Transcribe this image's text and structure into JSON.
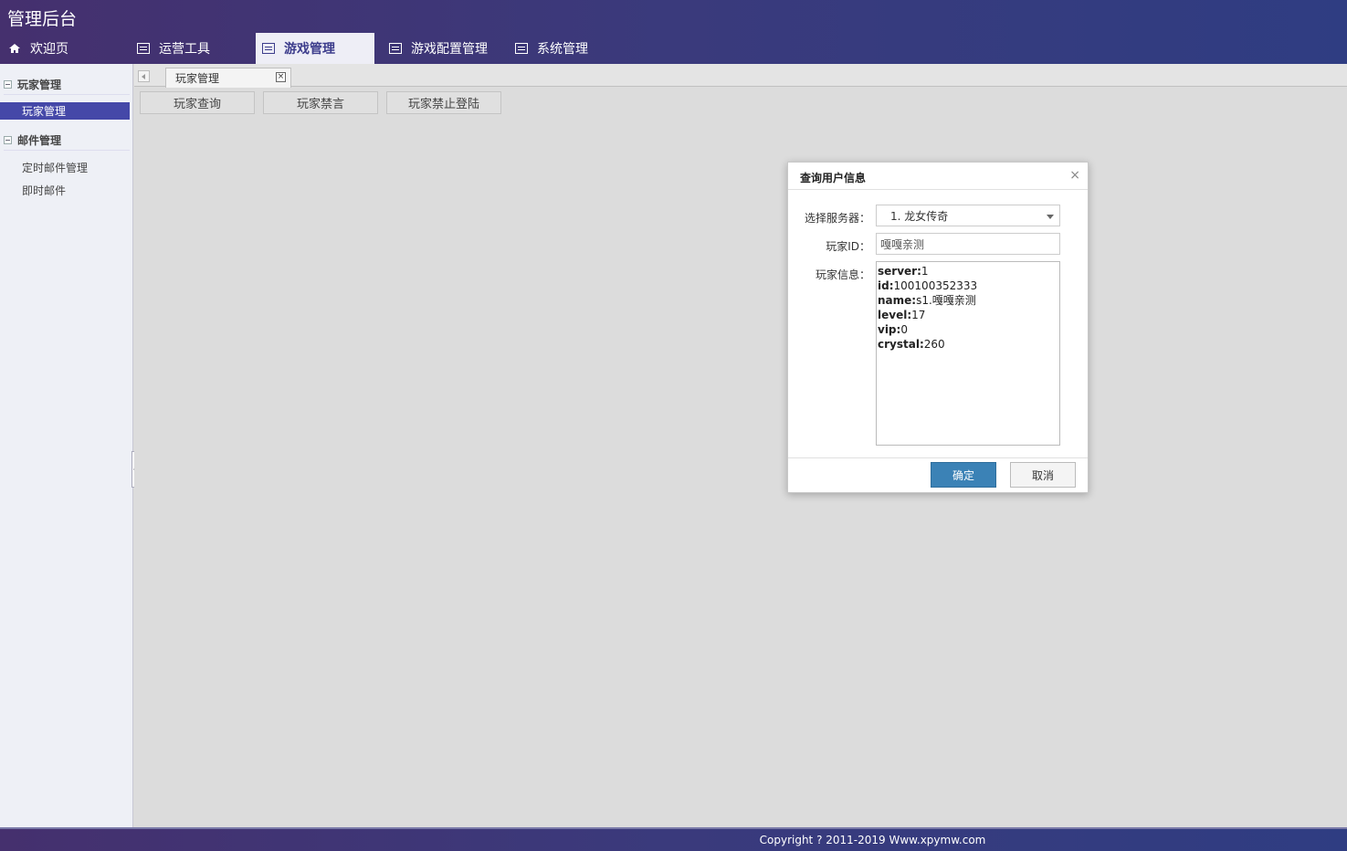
{
  "app": {
    "title": "管理后台"
  },
  "nav": {
    "items": [
      {
        "label": "欢迎页",
        "icon": "home-icon"
      },
      {
        "label": "运营工具",
        "icon": "list-icon"
      },
      {
        "label": "游戏管理",
        "icon": "list-icon",
        "active": true
      },
      {
        "label": "游戏配置管理",
        "icon": "list-icon"
      },
      {
        "label": "系统管理",
        "icon": "list-icon"
      }
    ]
  },
  "sidebar": {
    "groups": [
      {
        "title": "玩家管理",
        "items": [
          {
            "label": "玩家管理",
            "active": true
          }
        ]
      },
      {
        "title": "邮件管理",
        "items": [
          {
            "label": "定时邮件管理"
          },
          {
            "label": "即时邮件"
          }
        ]
      }
    ]
  },
  "content": {
    "tab": {
      "label": "玩家管理",
      "close": "×"
    },
    "buttons": [
      "玩家查询",
      "玩家禁言",
      "玩家禁止登陆"
    ]
  },
  "dialog": {
    "title": "查询用户信息",
    "close": "×",
    "server_label": "选择服务器：",
    "server_value": "1. 龙女传奇",
    "player_id_label": "玩家ID：",
    "player_id_value": "嘎嘎亲测",
    "info_label": "玩家信息：",
    "info": [
      {
        "key": "server:",
        "value": "1"
      },
      {
        "key": "id:",
        "value": "100100352333"
      },
      {
        "key": "name:",
        "value": "s1.嘎嘎亲测"
      },
      {
        "key": "level:",
        "value": "17"
      },
      {
        "key": "vip:",
        "value": "0"
      },
      {
        "key": "crystal:",
        "value": "260"
      }
    ],
    "ok_label": "确定",
    "cancel_label": "取消"
  },
  "footer": {
    "copyright": "Copyright ? 2011-2019 Www.xpymw.com"
  },
  "colors": {
    "header": "#3a3a7c",
    "active_side": "#4548a8",
    "ok_button": "#3b82b6"
  }
}
